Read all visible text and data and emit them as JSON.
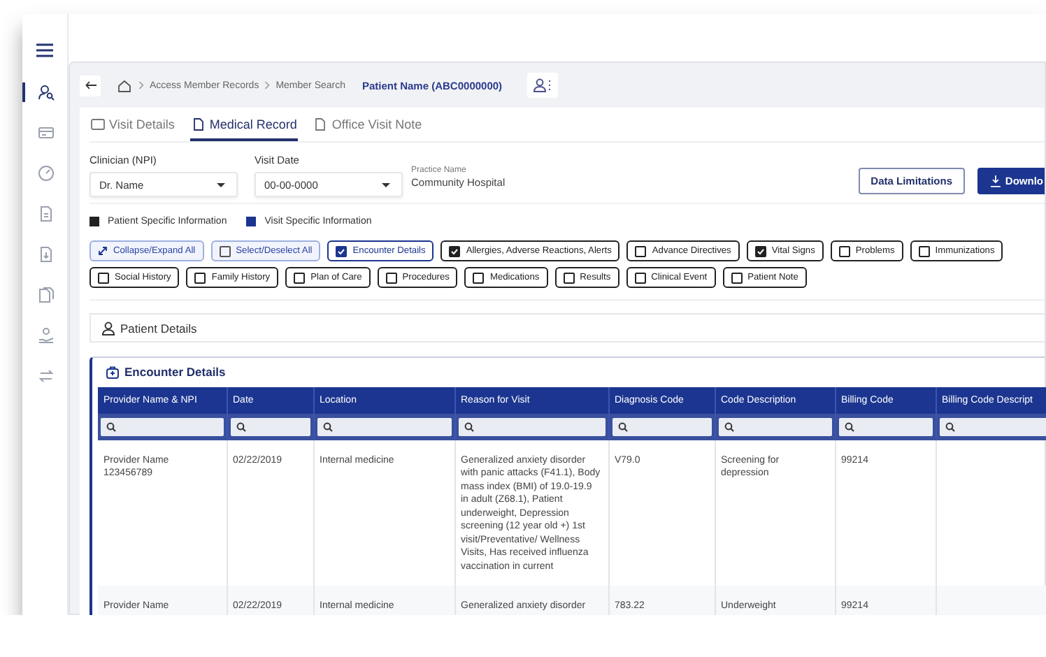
{
  "sidebar": {
    "items": [
      {
        "selected": true
      },
      {
        "selected": false
      },
      {
        "selected": false
      },
      {
        "selected": false
      },
      {
        "selected": false
      },
      {
        "selected": false
      },
      {
        "selected": false
      },
      {
        "selected": false
      }
    ]
  },
  "breadcrumb": {
    "items": [
      "Access Member Records",
      "Member Search"
    ],
    "patient": "Patient Name (ABC0000000)"
  },
  "tabs": [
    {
      "label": "Visit Details",
      "selected": false
    },
    {
      "label": "Medical Record",
      "selected": true
    },
    {
      "label": "Office Visit Note",
      "selected": false
    }
  ],
  "filters": {
    "clinician": {
      "label": "Clinician (NPI)",
      "value": "Dr. Name"
    },
    "visit_date": {
      "label": "Visit Date",
      "value": "00-00-0000"
    },
    "practice": {
      "label": "Practice Name",
      "value": "Community Hospital"
    }
  },
  "buttons": [
    {
      "label": "Data Limitations",
      "kind": "outline"
    },
    {
      "label": "Downlo",
      "kind": "primary"
    }
  ],
  "legend": [
    {
      "label": "Patient Specific Information",
      "color": "#222222"
    },
    {
      "label": "Visit Specific Information",
      "color": "#1b3590"
    }
  ],
  "chips": [
    {
      "label": "Collapse/Expand All",
      "kind": "action"
    },
    {
      "label": "Select/Deselect All",
      "kind": "select",
      "checked": false
    },
    {
      "label": "Encounter Details",
      "kind": "toggle",
      "color": "#1b3590",
      "checked": true
    },
    {
      "label": "Allergies, Adverse Reactions, Alerts",
      "kind": "toggle",
      "color": "#222222",
      "checked": true
    },
    {
      "label": "Advance Directives",
      "kind": "toggle",
      "color": "#222222",
      "checked": false
    },
    {
      "label": "Vital Signs",
      "kind": "toggle",
      "color": "#222222",
      "checked": true
    },
    {
      "label": "Problems",
      "kind": "toggle",
      "color": "#222222",
      "checked": false
    },
    {
      "label": "Immunizations",
      "kind": "toggle",
      "color": "#222222",
      "checked": false
    },
    {
      "label": "Social History",
      "kind": "toggle",
      "color": "#222222",
      "checked": false
    },
    {
      "label": "Family History",
      "kind": "toggle",
      "color": "#222222",
      "checked": false
    },
    {
      "label": "Plan of Care",
      "kind": "toggle",
      "color": "#222222",
      "checked": false
    },
    {
      "label": "Procedures",
      "kind": "toggle",
      "color": "#222222",
      "checked": false
    },
    {
      "label": "Medications",
      "kind": "toggle",
      "color": "#222222",
      "checked": false
    },
    {
      "label": "Results",
      "kind": "toggle",
      "color": "#222222",
      "checked": false
    },
    {
      "label": "Clinical Event",
      "kind": "toggle",
      "color": "#222222",
      "checked": false
    },
    {
      "label": "Patient Note",
      "kind": "toggle",
      "color": "#222222",
      "checked": false
    }
  ],
  "patient_details": {
    "title": "Patient Details"
  },
  "encounter": {
    "title": "Encounter Details",
    "columns": [
      "Provider Name & NPI",
      "Date",
      "Location",
      "Reason for Visit",
      "Diagnosis Code",
      "Code Description",
      "Billing Code",
      "Billing Code Descript"
    ],
    "rows": [
      [
        "Provider Name 123456789",
        "02/22/2019",
        "Internal medicine",
        "Generalized anxiety disorder with panic attacks (F41.1), Body mass index (BMI) of 19.0-19.9 in adult (Z68.1), Patient underweight, Depression screening (12 year old +) 1st visit/Preventative/ Wellness Visits, Has received influenza vaccination in current",
        "V79.0",
        "Screening for depression",
        "99214"
      ],
      [
        "Provider Name",
        "02/22/2019",
        "Internal medicine",
        "Generalized anxiety disorder",
        "783.22",
        "Underweight",
        "99214"
      ]
    ]
  }
}
